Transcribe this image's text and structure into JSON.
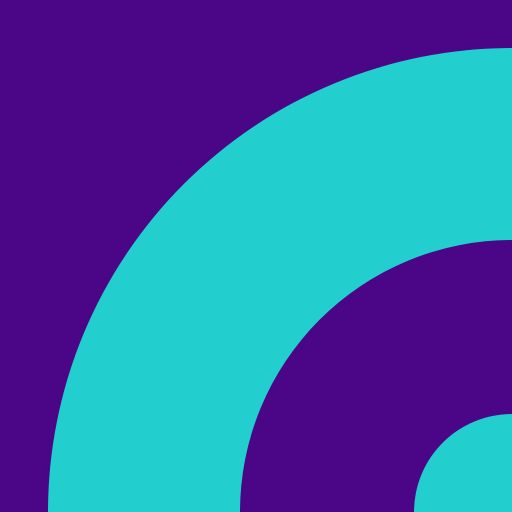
{
  "artwork": {
    "icon": "concentric-quarter-arcs",
    "colors": {
      "background": "#4a0687",
      "arc": "#22cece"
    }
  }
}
